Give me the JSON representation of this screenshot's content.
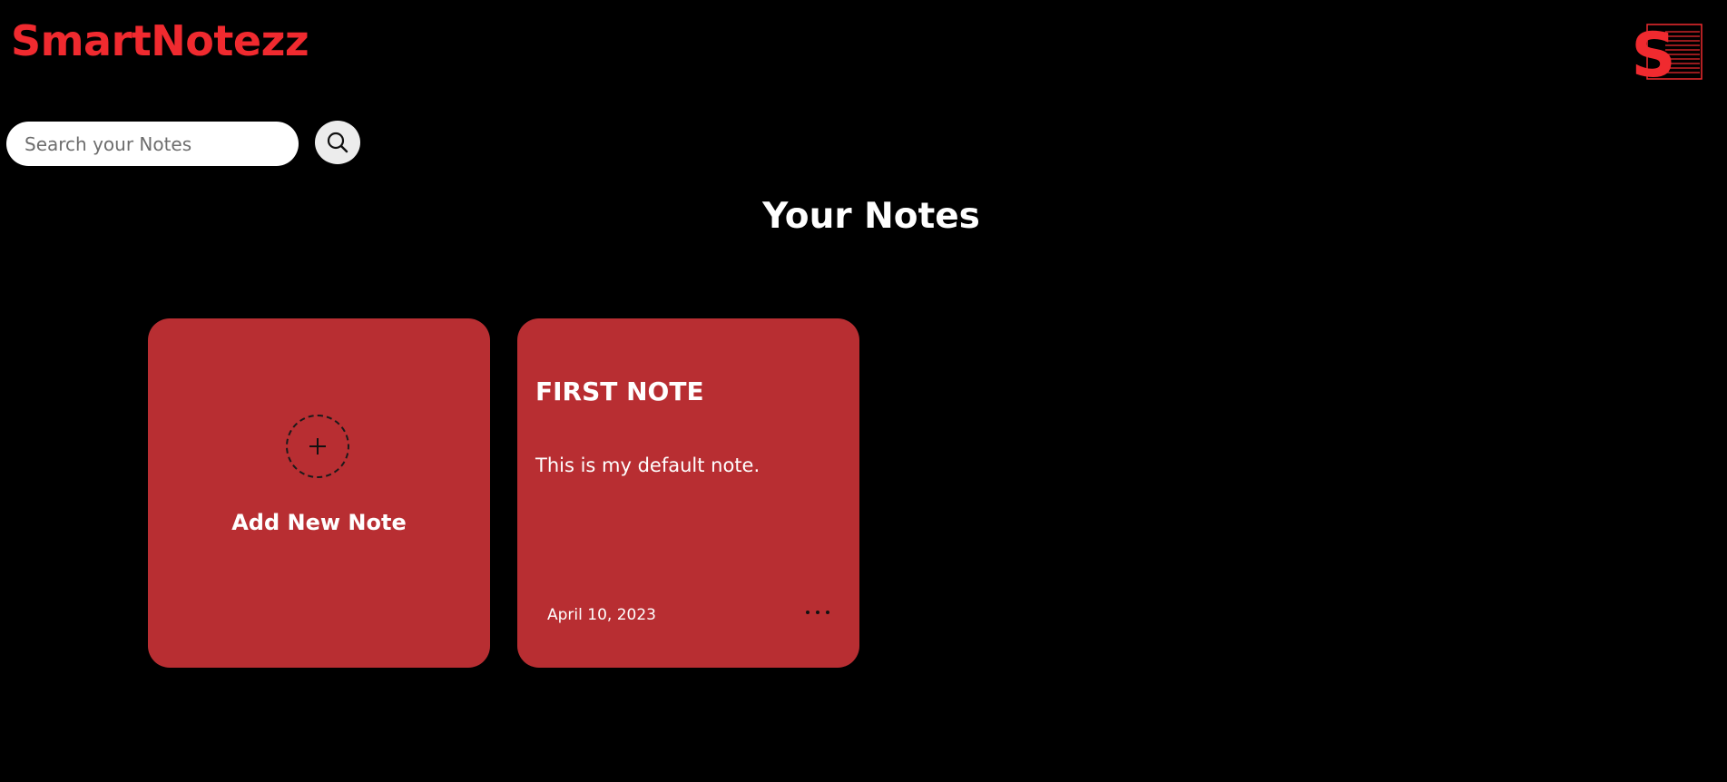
{
  "app": {
    "name": "SmartNotezz",
    "logo_letter": "S"
  },
  "colors": {
    "background": "#000000",
    "brand": "#f02a2f",
    "card": "#b82e32"
  },
  "search": {
    "placeholder": "Search your Notes",
    "value": "",
    "button_icon": "search-icon"
  },
  "main": {
    "title": "Your Notes",
    "add_card": {
      "label": "Add New Note",
      "icon": "plus-icon"
    },
    "notes": [
      {
        "title": "FIRST NOTE",
        "body": "This is my default note.",
        "date": "April 10, 2023",
        "menu_icon": "more-icon"
      }
    ]
  }
}
